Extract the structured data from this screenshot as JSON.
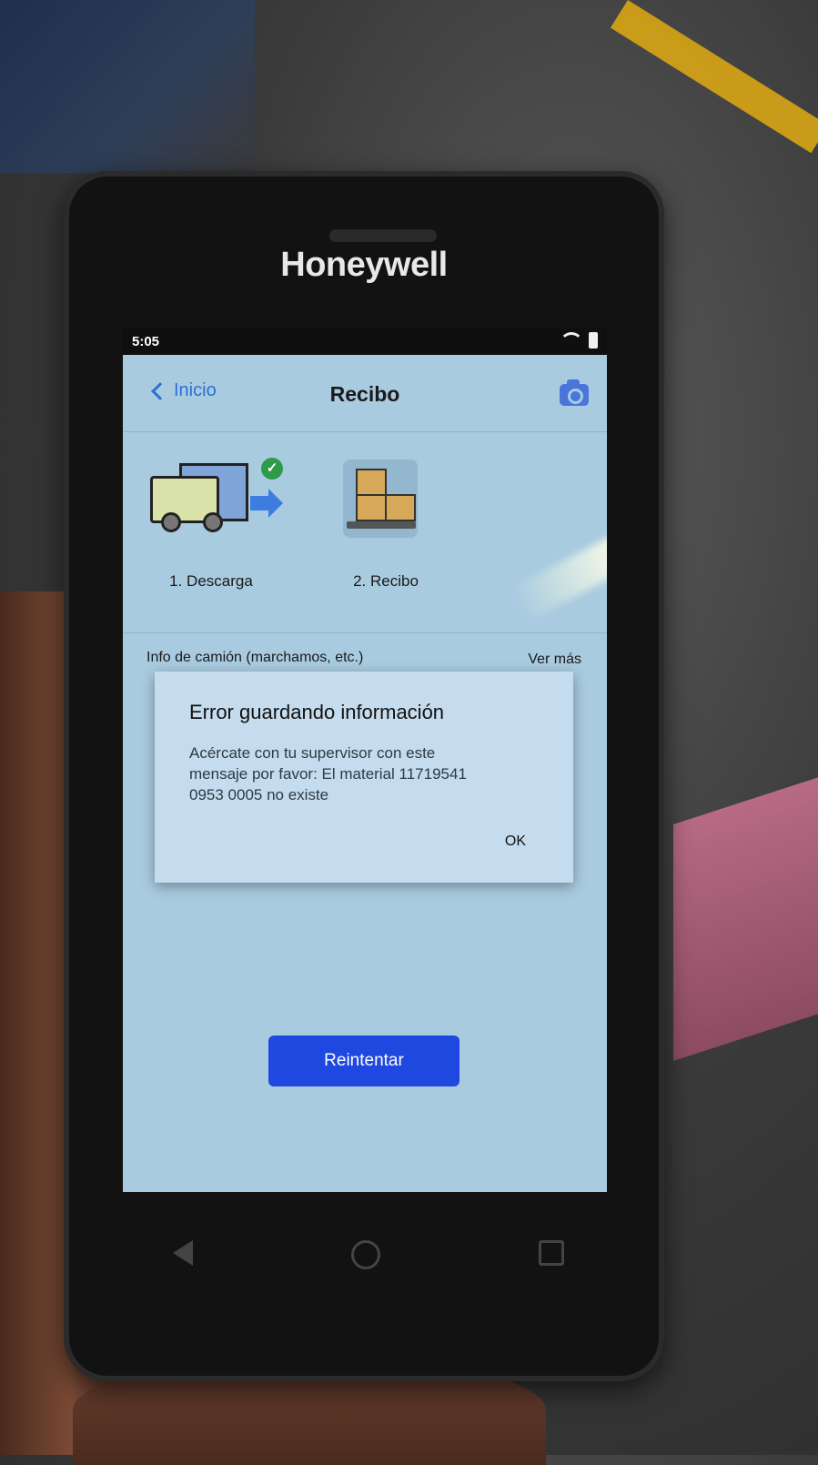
{
  "device": {
    "brand": "Honeywell"
  },
  "status_bar": {
    "time": "5:05",
    "icons": [
      "wifi-icon",
      "battery-icon"
    ]
  },
  "app_bar": {
    "back_label": "Inicio",
    "title": "Recibo",
    "action_icon": "camera-icon"
  },
  "steps": [
    {
      "label": "1. Descarga",
      "icon": "truck-icon",
      "completed": true
    },
    {
      "label": "2. Recibo",
      "icon": "boxes-pallet-icon",
      "completed": false
    }
  ],
  "info": {
    "label": "Info de camión (marchamos, etc.)",
    "link": "Ver más"
  },
  "retry_button": {
    "label": "Reintentar"
  },
  "dialog": {
    "title": "Error guardando información",
    "message_lines": [
      "Acércate con tu supervisor con este",
      "mensaje por favor: El material 11719541",
      "0953 0005 no existe"
    ],
    "ok_label": "OK"
  },
  "colors": {
    "accent": "#1e48e0",
    "link": "#2e6fd6",
    "success": "#2e9b4a"
  }
}
